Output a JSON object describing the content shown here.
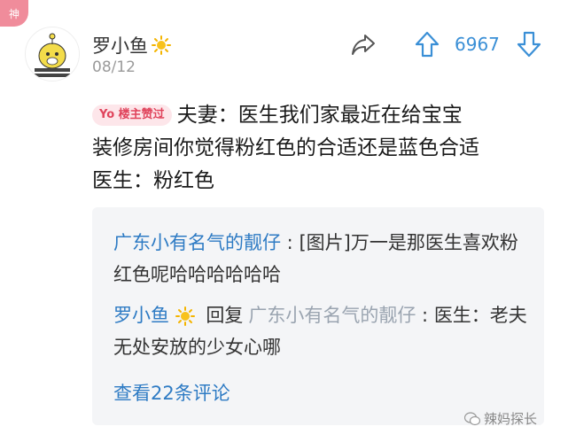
{
  "badge": {
    "corner": "神"
  },
  "post": {
    "username": "罗小鱼",
    "date": "08/12",
    "vote_count": "6967",
    "owner_badge": "Yo 楼主赞过",
    "lines": [
      "夫妻：医生我们家最近在给宝宝",
      "装修房间你觉得粉红色的合适还是蓝色合适",
      "医生：粉红色"
    ]
  },
  "comments": [
    {
      "author": "广东小有名气的靓仔",
      "sep": " : ",
      "text": "[图片]万一是那医生喜欢粉红色呢哈哈哈哈哈哈"
    },
    {
      "author": "罗小鱼",
      "reply_word": "回复",
      "reply_to": "广东小有名气的靓仔",
      "sep": " : ",
      "text": "医生：老夫无处安放的少女心哪"
    }
  ],
  "view_more": "查看22条评论",
  "watermark": "辣妈探长",
  "colors": {
    "accent_blue": "#3a8fd6",
    "badge_pink": "#f08c9b",
    "link_blue": "#2e7bc4"
  }
}
